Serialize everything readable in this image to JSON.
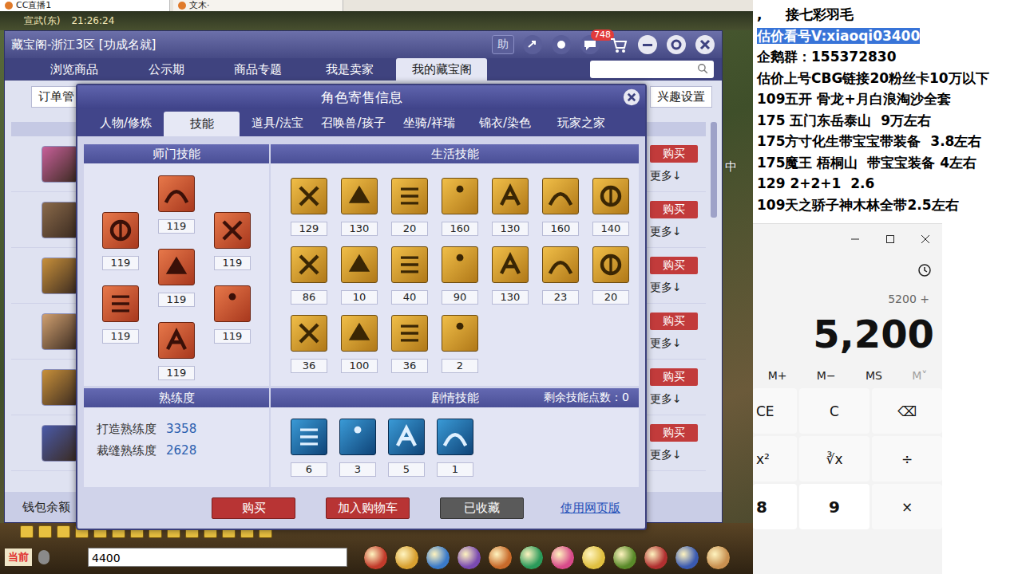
{
  "browser_tabs": [
    {
      "label": "CC直播1",
      "selected": true
    },
    {
      "label": "文木·",
      "selected": false
    }
  ],
  "game": {
    "location": "宣武(东)",
    "clock": "21:26:24",
    "side_text": "中",
    "chat_channel": "当前",
    "chat_input": "4400"
  },
  "cbg": {
    "title": "藏宝阁-浙江3区 [功成名就]",
    "help": "助",
    "message_badge": "748",
    "nav_tabs": [
      {
        "label": "浏览商品",
        "selected": false
      },
      {
        "label": "公示期",
        "selected": false
      },
      {
        "label": "商品专题",
        "selected": false
      },
      {
        "label": "我是卖家",
        "selected": false
      },
      {
        "label": "我的藏宝阁",
        "selected": true
      }
    ],
    "order_button": "订单管",
    "interest_button": "兴趣设置",
    "wallet": "钱包余额",
    "rows": [
      {
        "buy": "购买",
        "more": "更多↓",
        "color": "#c8609a"
      },
      {
        "buy": "购买",
        "more": "更多↓",
        "color": "#8a6a4a"
      },
      {
        "buy": "购买",
        "more": "更多↓",
        "color": "#c8903a"
      },
      {
        "buy": "购买",
        "more": "更多↓",
        "color": "#d0a070"
      },
      {
        "buy": "购买",
        "more": "更多↓",
        "color": "#c8903a"
      },
      {
        "buy": "购买",
        "more": "更多↓",
        "color": "#4a5aa8"
      }
    ]
  },
  "dialog": {
    "title": "角色寄售信息",
    "tabs": [
      {
        "label": "人物/修炼",
        "selected": false
      },
      {
        "label": "技能",
        "selected": true
      },
      {
        "label": "道具/法宝",
        "selected": false
      },
      {
        "label": "召唤兽/孩子",
        "selected": false
      },
      {
        "label": "坐骑/祥瑞",
        "selected": false
      },
      {
        "label": "锦衣/染色",
        "selected": false
      },
      {
        "label": "玩家之家",
        "selected": false
      }
    ],
    "sect_header": "师门技能",
    "sect_skills": [
      {
        "value": "119"
      },
      {
        "value": "119"
      },
      {
        "value": "119"
      },
      {
        "value": "119"
      },
      {
        "value": "119"
      },
      {
        "value": "119"
      },
      {
        "value": "119"
      }
    ],
    "life_header": "生活技能",
    "life_skills": [
      {
        "value": "129"
      },
      {
        "value": "130"
      },
      {
        "value": "20"
      },
      {
        "value": "160"
      },
      {
        "value": "130"
      },
      {
        "value": "160"
      },
      {
        "value": "140"
      },
      {
        "value": "86"
      },
      {
        "value": "10"
      },
      {
        "value": "40"
      },
      {
        "value": "90"
      },
      {
        "value": "130"
      },
      {
        "value": "23"
      },
      {
        "value": "20"
      },
      {
        "value": "36"
      },
      {
        "value": "100"
      },
      {
        "value": "36"
      },
      {
        "value": "2"
      }
    ],
    "proficiency_header": "熟练度",
    "proficiency": [
      {
        "label": "打造熟练度",
        "value": "3358"
      },
      {
        "label": "裁缝熟练度",
        "value": "2628"
      }
    ],
    "plot_header": "剧情技能",
    "remaining_label": "剩余技能点数：",
    "remaining_value": "0",
    "plot_skills": [
      {
        "value": "6"
      },
      {
        "value": "3"
      },
      {
        "value": "5"
      },
      {
        "value": "1"
      }
    ],
    "buttons": [
      {
        "label": "购买",
        "kind": "red"
      },
      {
        "label": "加入购物车",
        "kind": "red"
      },
      {
        "label": "已收藏",
        "kind": "grey"
      },
      {
        "label": "使用网页版",
        "kind": "link"
      }
    ]
  },
  "notes": {
    "lines": [
      {
        "text": ",     接七彩羽毛",
        "highlighted": false
      },
      {
        "text": "估价看号V:xiaoqi03400",
        "highlighted": true
      },
      {
        "text": "企鹅群：155372830",
        "highlighted": false
      },
      {
        "text": "估价上号CBG链接20粉丝卡10万以下",
        "highlighted": false
      },
      {
        "text": "109五开 骨龙+月白浪淘沙全套",
        "highlighted": false
      },
      {
        "text": "175 五门东岳泰山  9万左右",
        "highlighted": false
      },
      {
        "text": "175方寸化生带宝宝带装备  3.8左右",
        "highlighted": false
      },
      {
        "text": "175魔王 梧桐山  带宝宝装备 4左右",
        "highlighted": false
      },
      {
        "text": "129 2+2+1  2.6",
        "highlighted": false
      },
      {
        "text": "109天之骄子神木林全带2.5左右",
        "highlighted": false
      }
    ]
  },
  "calculator": {
    "expression": "5200 +",
    "display": "5,200",
    "memory": [
      {
        "label": "M+",
        "disabled": false
      },
      {
        "label": "M−",
        "disabled": false
      },
      {
        "label": "MS",
        "disabled": false
      },
      {
        "label": "M˅",
        "disabled": true
      }
    ],
    "keys": [
      [
        {
          "label": "CE",
          "kind": "op"
        },
        {
          "label": "C",
          "kind": "op"
        },
        {
          "label": "⌫",
          "kind": "op"
        }
      ],
      [
        {
          "label": "x²",
          "kind": "op"
        },
        {
          "label": "∛x",
          "kind": "op"
        },
        {
          "label": "÷",
          "kind": "op"
        }
      ],
      [
        {
          "label": "8",
          "kind": "digit"
        },
        {
          "label": "9",
          "kind": "digit"
        },
        {
          "label": "×",
          "kind": "op"
        }
      ]
    ]
  }
}
